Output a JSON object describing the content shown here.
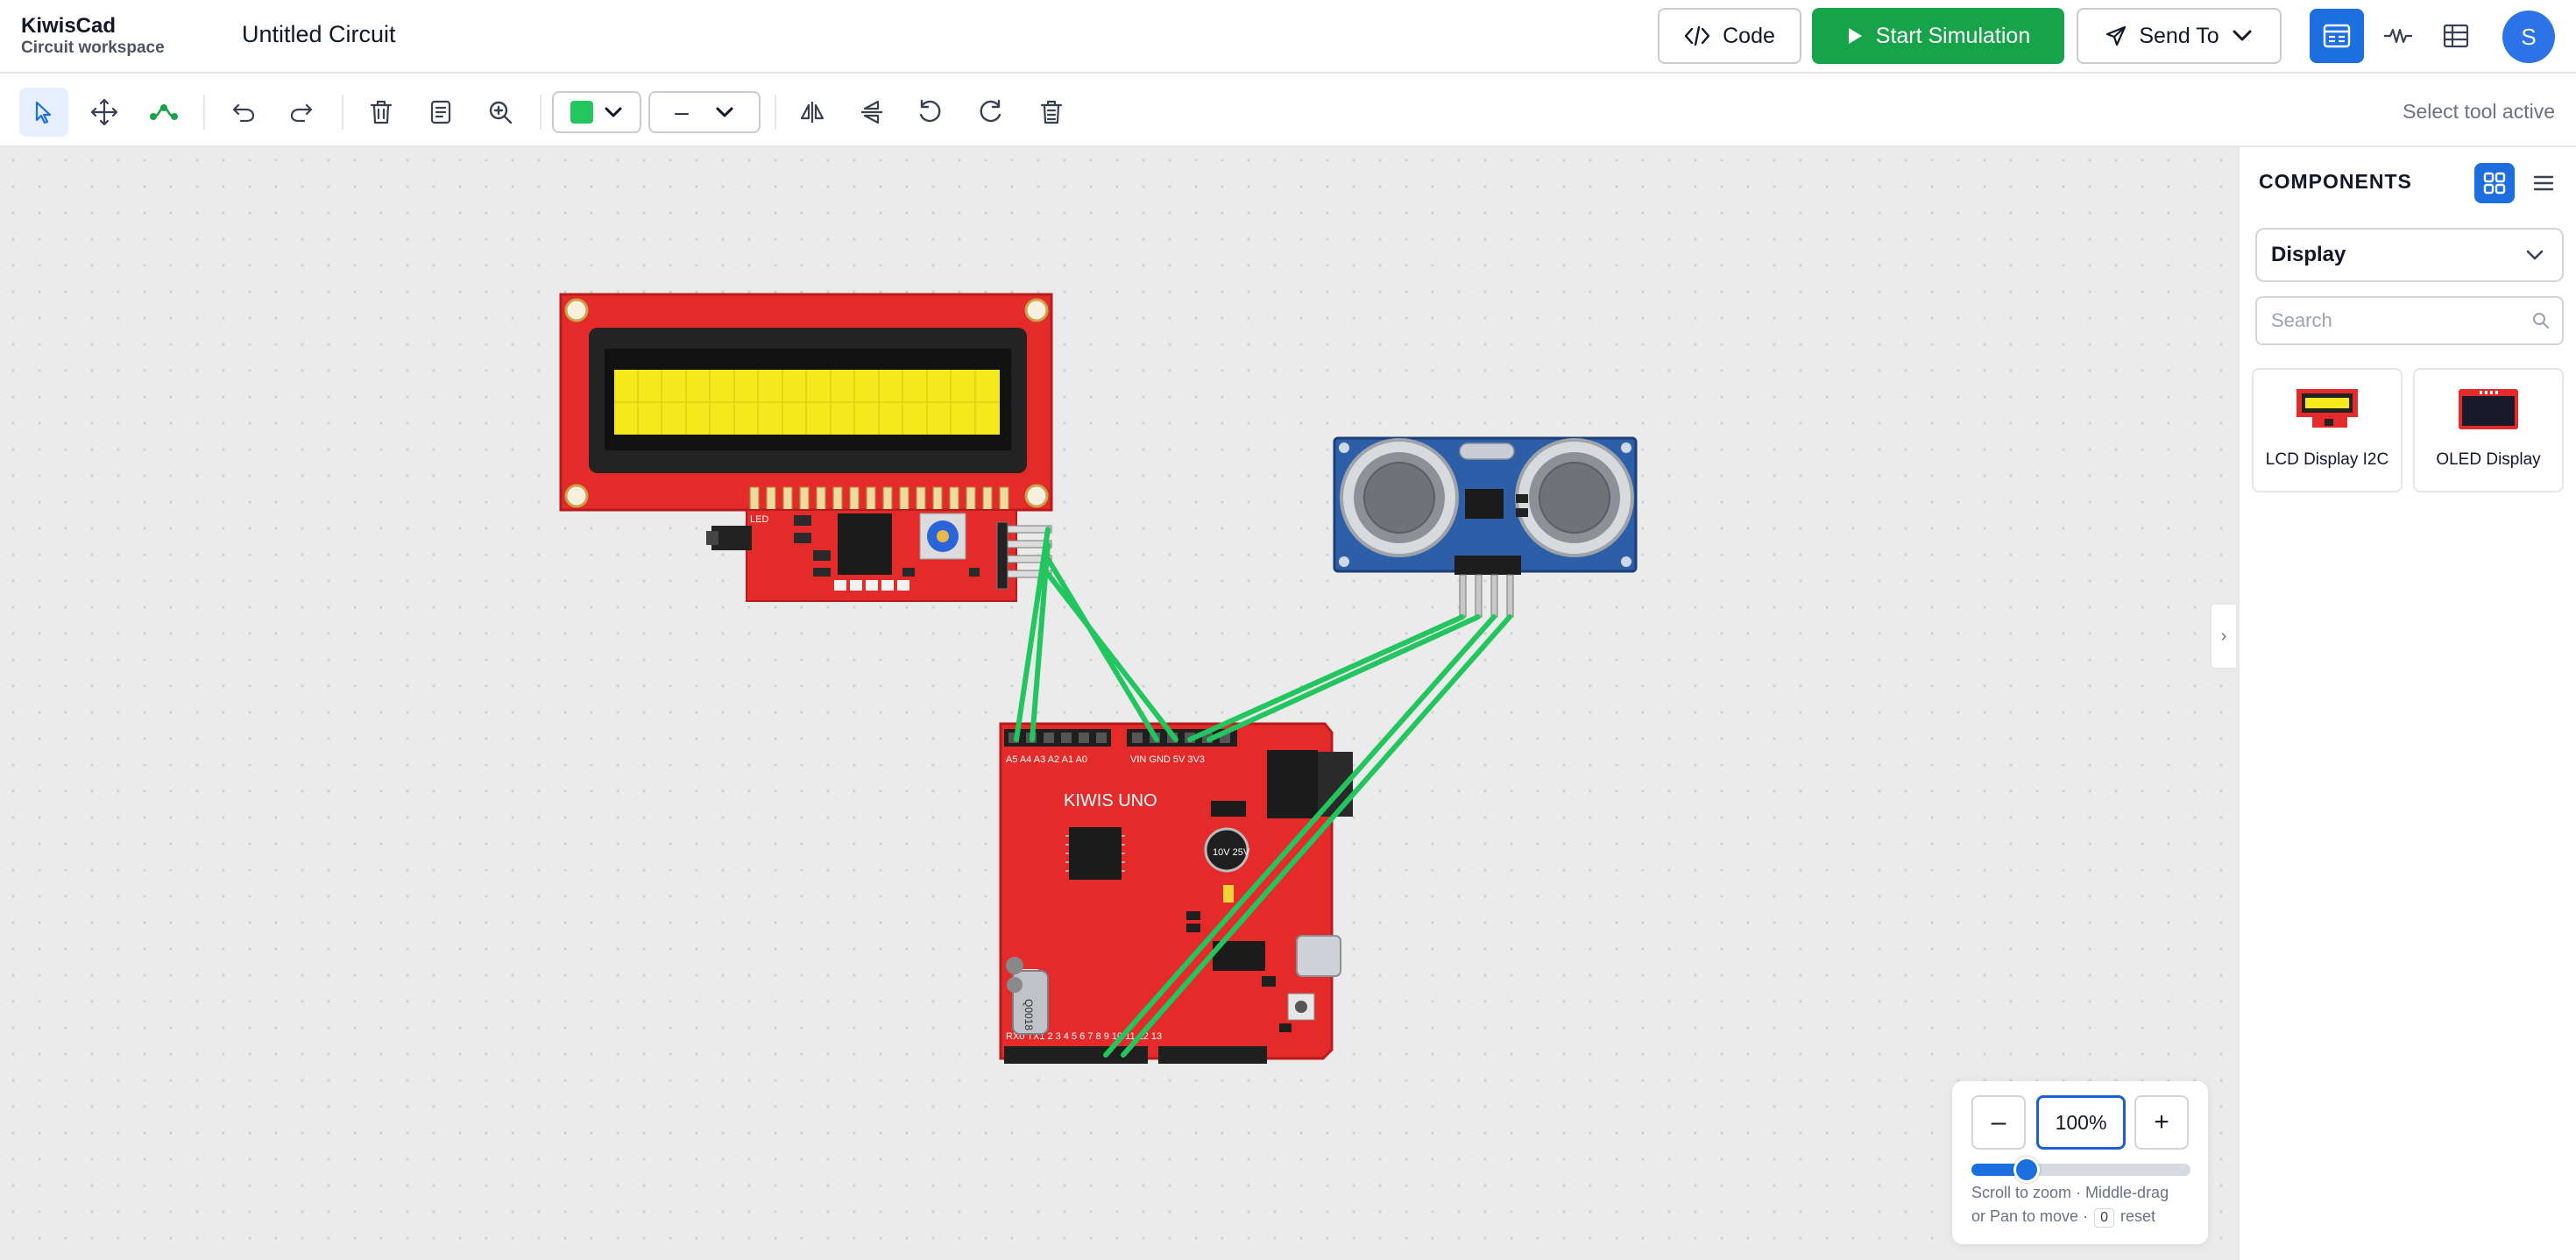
{
  "header": {
    "brand_name": "KiwisCad",
    "brand_sub": "Circuit workspace",
    "doc_title": "Untitled Circuit",
    "code_label": "Code",
    "sim_label": "Start Simulation",
    "send_label": "Send To",
    "avatar_initial": "S",
    "accent": "#1d6fe0",
    "sim_color": "#16a34a"
  },
  "toolbar": {
    "tools": [
      "select-tool",
      "move-tool",
      "wire-tool",
      "undo",
      "redo",
      "delete",
      "notes",
      "zoom-tool",
      "flip-horizontal",
      "flip-vertical",
      "rotate-ccw",
      "rotate-cw",
      "clear"
    ],
    "active_tool": "select-tool",
    "wire_color": "#22c55e",
    "line_style": "–",
    "status": "Select tool active"
  },
  "canvas": {
    "components": {
      "lcd": {
        "labels": [
          "LED"
        ]
      },
      "board": {
        "brand": "KIWIS UNO",
        "crystal": "Q0018",
        "cap": "10V 25V",
        "header_top_left": "A5 A4 A3 A2 A1 A0",
        "header_top_mid": "VIN GND 5V 3V3",
        "header_bottom": "RX0 TX1 2 3 4 5 6 7 8 9 10 11 12 13"
      },
      "sensor": {
        "name": "ultrasonic-sensor"
      }
    },
    "wire_color": "#22c55e",
    "collapse_glyph": "›"
  },
  "zoom": {
    "minus": "–",
    "plus": "+",
    "value": "100%",
    "level": 0.25,
    "hint_line1": "Scroll to zoom · Middle-drag",
    "hint_pre": "or Pan to move ·",
    "hint_key": "0",
    "hint_post": "reset"
  },
  "sidebar": {
    "title": "COMPONENTS",
    "category": "Display",
    "search_placeholder": "Search",
    "cards": [
      {
        "label": "LCD Display I2C"
      },
      {
        "label": "OLED Display"
      }
    ]
  }
}
